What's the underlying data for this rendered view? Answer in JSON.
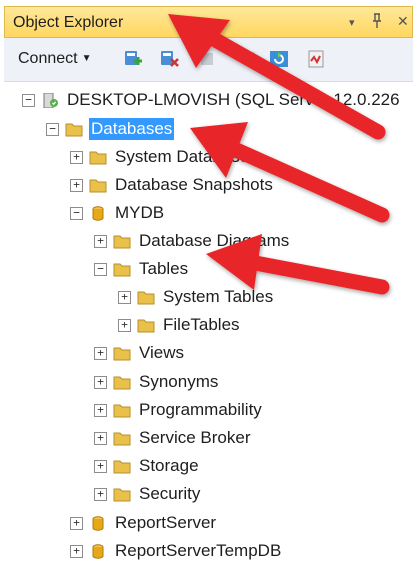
{
  "panel": {
    "title": "Object Explorer",
    "controls": {
      "dropdown": "▾",
      "pin": "ᴘ",
      "close": "✕"
    }
  },
  "toolbar": {
    "connect_label": "Connect",
    "buttons": [
      "connect-object-icon",
      "disconnect-icon",
      "stop-icon",
      "filter-icon",
      "refresh-icon",
      "activity-monitor-icon"
    ]
  },
  "tree": {
    "server": "DESKTOP-LMOVISH (SQL Server 12.0.226",
    "databases": "Databases",
    "system_databases": "System Databases",
    "database_snapshots": "Database Snapshots",
    "mydb": "MYDB",
    "database_diagrams": "Database Diagrams",
    "tables": "Tables",
    "system_tables": "System Tables",
    "filetables": "FileTables",
    "views": "Views",
    "synonyms": "Synonyms",
    "programmability": "Programmability",
    "service_broker": "Service Broker",
    "storage": "Storage",
    "security": "Security",
    "reportserver": "ReportServer",
    "reportservertempdb": "ReportServerTempDB"
  },
  "colors": {
    "titlebar": "#ffd760",
    "selection": "#3399ff",
    "arrow": "#e8262a",
    "folder": "#e8c04a",
    "database": "#e6a817"
  }
}
